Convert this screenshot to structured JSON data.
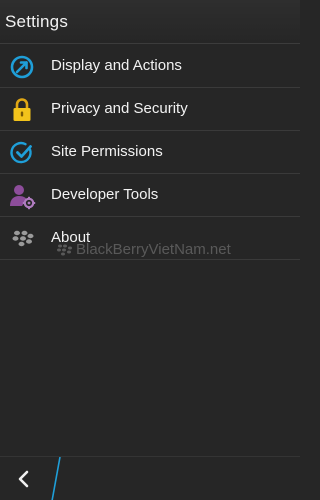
{
  "header": {
    "title": "Settings"
  },
  "menu": {
    "items": [
      {
        "label": "Display and Actions",
        "icon": "display-actions-icon"
      },
      {
        "label": "Privacy and Security",
        "icon": "lock-icon"
      },
      {
        "label": "Site Permissions",
        "icon": "check-icon"
      },
      {
        "label": "Developer Tools",
        "icon": "developer-gear-icon"
      },
      {
        "label": "About",
        "icon": "blackberry-icon"
      }
    ]
  },
  "watermark": {
    "text": "BlackBerryVietNam.net"
  },
  "footer": {
    "back_icon": "back-chevron-icon"
  },
  "colors": {
    "accent_blue": "#1f9fd9",
    "lock_yellow": "#f2c31b",
    "developer_purple": "#8d4d9b",
    "background": "#262626"
  }
}
